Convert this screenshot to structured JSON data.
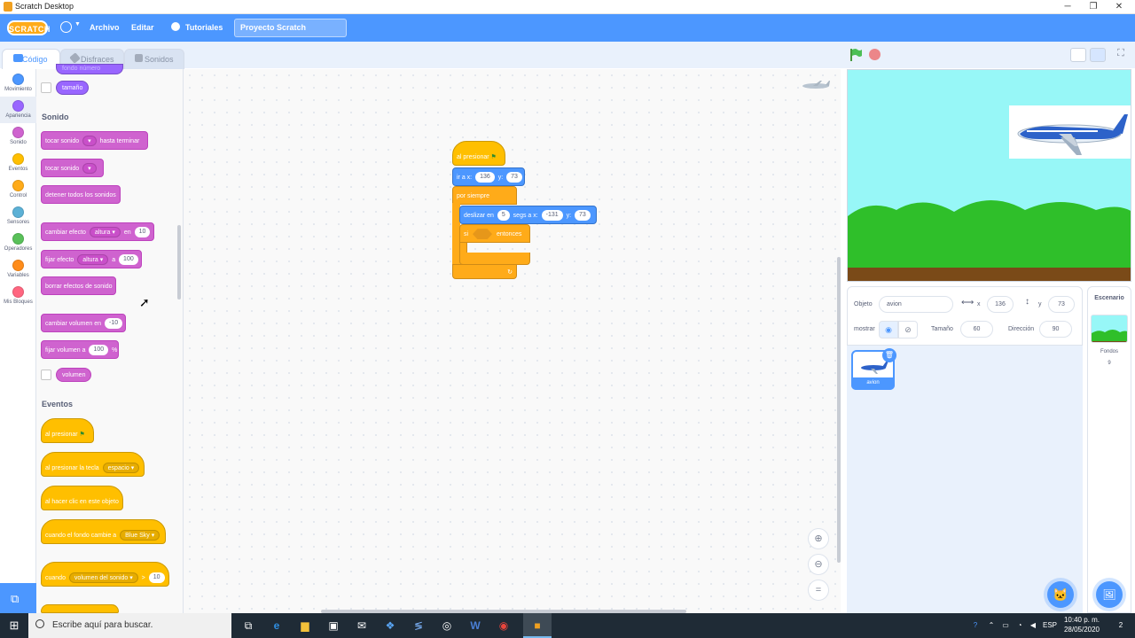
{
  "window": {
    "title": "Scratch Desktop"
  },
  "menubar": {
    "logo": "SCRATCH",
    "items": [
      "Archivo",
      "Editar",
      "Tutoriales"
    ],
    "project_title": "Proyecto Scratch"
  },
  "tabs": [
    {
      "label": "Código",
      "icon": "code-icon"
    },
    {
      "label": "Disfraces",
      "icon": "brush-icon"
    },
    {
      "label": "Sonidos",
      "icon": "speaker-icon"
    }
  ],
  "categories": [
    {
      "label": "Movimiento",
      "color": "#4c97ff"
    },
    {
      "label": "Apariencia",
      "color": "#9966ff"
    },
    {
      "label": "Sonido",
      "color": "#cf63cf"
    },
    {
      "label": "Eventos",
      "color": "#ffbf00"
    },
    {
      "label": "Control",
      "color": "#ffab19"
    },
    {
      "label": "Sensores",
      "color": "#5cb1d6"
    },
    {
      "label": "Operadores",
      "color": "#59c059"
    },
    {
      "label": "Variables",
      "color": "#ff8c1a"
    },
    {
      "label": "Mis Bloques",
      "color": "#ff6680"
    }
  ],
  "palette": {
    "looks_reporter_partial": "fondo número",
    "size_reporter": "tamaño",
    "sound_title": "Sonido",
    "sound_blocks": {
      "play_until_done": "tocar sonido",
      "play_until_done_suffix": "hasta terminar",
      "play": "tocar sonido",
      "stop_all": "detener todos los sonidos",
      "change_effect": "cambiar efecto",
      "change_effect_dd": "altura",
      "change_effect_by": "en",
      "change_effect_val": "10",
      "set_effect": "fijar efecto",
      "set_effect_dd": "altura",
      "set_effect_to": "a",
      "set_effect_val": "100",
      "clear_effects": "borrar efectos de sonido",
      "change_volume": "cambiar volumen en",
      "change_volume_val": "-10",
      "set_volume": "fijar volumen a",
      "set_volume_val": "100",
      "set_volume_unit": "%",
      "volume_reporter": "volumen"
    },
    "events_title": "Eventos",
    "event_blocks": {
      "flag": "al presionar",
      "key": "al presionar la tecla",
      "key_dd": "espacio",
      "sprite_click": "al hacer clic en este objeto",
      "backdrop_switch": "cuando el fondo cambie a",
      "backdrop_dd": "Blue Sky",
      "greater_than": "cuando",
      "greater_dd": "volumen del sonido",
      "greater_op": ">",
      "greater_val": "10"
    }
  },
  "script": {
    "hat": "al presionar",
    "goto_label": "ir a x:",
    "goto_x": "136",
    "goto_y_label": "y:",
    "goto_y": "73",
    "forever": "por siempre",
    "glide_label": "deslizar en",
    "glide_secs": "5",
    "glide_mid": "segs a x:",
    "glide_x": "-131",
    "glide_y_label": "y:",
    "glide_y": "73",
    "if_label": "si",
    "if_then": "entonces",
    "loop_arrow": "↻"
  },
  "sprite_info": {
    "sprite_label": "Objeto",
    "sprite_name": "avion",
    "x_label": "x",
    "x": "136",
    "y_label": "y",
    "y": "73",
    "show_label": "mostrar",
    "size_label": "Tamaño",
    "size": "60",
    "direction_label": "Dirección",
    "direction": "90"
  },
  "sprites": [
    {
      "name": "avion"
    }
  ],
  "stage_pane": {
    "title": "Escenario",
    "backdrops_label": "Fondos",
    "backdrops_count": "9"
  },
  "taskbar": {
    "search_placeholder": "Escribe aquí para buscar.",
    "time": "10:40 p. m.",
    "date": "28/05/2020",
    "lang": "ESP",
    "notifications": "2"
  }
}
